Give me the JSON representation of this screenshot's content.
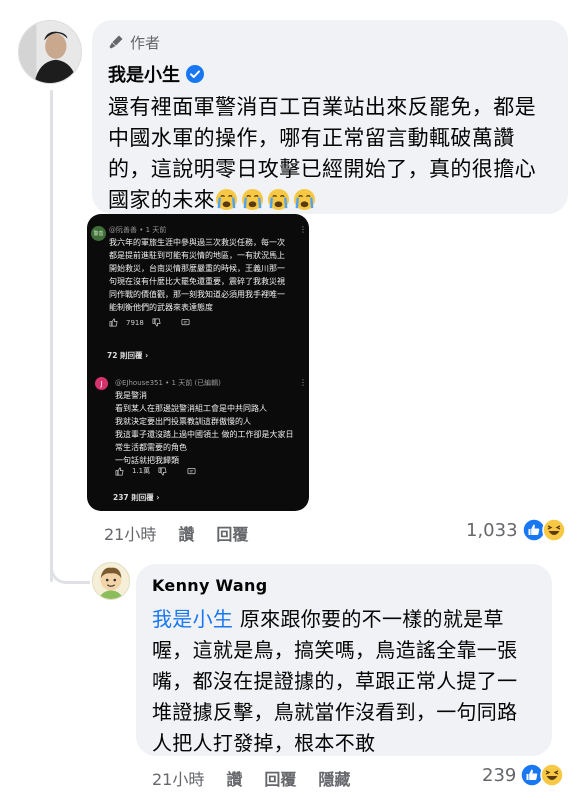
{
  "main_comment": {
    "author_badge": "作者",
    "author_name": "我是小生",
    "text": "還有裡面軍警消百工百業站出來反罷免，都是中國水軍的操作，哪有正常留言動輒破萬讚的，這說明零日攻擊已經開始了，真的很擔心國家的未來",
    "emojis": [
      "crying-face",
      "crying-face",
      "crying-face",
      "crying-face"
    ],
    "time": "21小時",
    "like_label": "讚",
    "reply_label": "回覆",
    "reaction_count": "1,033"
  },
  "embedded_screenshot": {
    "comment1": {
      "avatar_text": "警善",
      "handle": "@阮善善 • 1 天前",
      "lines": [
        "我六年的軍旅生涯中參與過三次救災任務，每一次",
        "都是提前進駐到可能有災情的地區，一有狀況馬上",
        "開始救災，台南災情那麼嚴重的時候，王義川那一",
        "句現在沒有什麼比大罷免還重要，震碎了我救災視",
        "同作戰的價值觀，那一刻我知道必須用我手裡唯一",
        "能制衡他們的武器來表達態度"
      ],
      "likes": "7918",
      "replies": "72 則回覆"
    },
    "comment2": {
      "avatar_text": "J",
      "handle": "@EJhouse351 • 1 天前 (已編輯)",
      "lines": [
        "我是警消",
        "看到某人在那邊說警消組工會是中共同路人",
        "我就決定要出門投票教訓這群傲慢的人",
        "我這輩子還沒踏上過中國領土 做的工作卻是大家日",
        "常生活都需要的角色",
        "一句話就把我歸類"
      ],
      "likes": "1.1萬",
      "replies": "237 則回覆"
    }
  },
  "reply_comment": {
    "author_name": "Kenny Wang",
    "mention": "我是小生",
    "text": " 原來跟你要的不一樣的就是草喔，這就是鳥，搞笑嗎，鳥造謠全靠一張嘴，都沒在提證據的，草跟正常人提了一堆證據反擊，鳥就當作沒看到，一句同路人把人打發掉，根本不敢",
    "time": "21小時",
    "like_label": "讚",
    "reply_label": "回覆",
    "hide_label": "隱藏",
    "reaction_count": "239"
  },
  "colors": {
    "bubble_bg": "#f0f2f5",
    "link_blue": "#1877f2",
    "meta_gray": "#65676b",
    "embedded_bg": "#0b0b0b"
  }
}
